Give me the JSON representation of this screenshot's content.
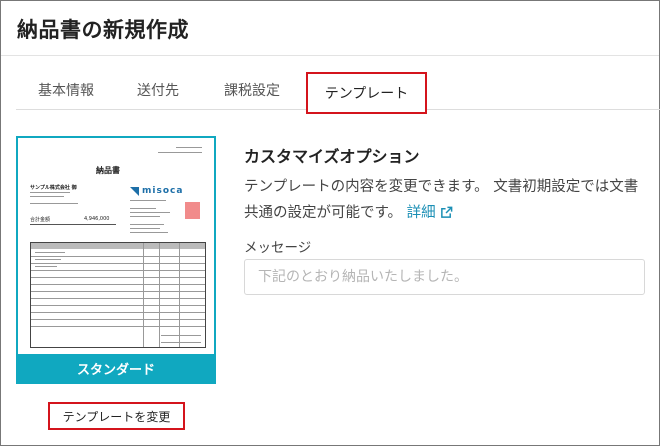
{
  "page": {
    "title": "納品書の新規作成"
  },
  "tabs": [
    {
      "label": "基本情報"
    },
    {
      "label": "送付先"
    },
    {
      "label": "課税設定"
    },
    {
      "label": "テンプレート"
    }
  ],
  "template": {
    "name": "スタンダード",
    "change_label": "テンプレートを変更",
    "preview": {
      "doc_title": "納品書",
      "customer": "サンプル株式会社 御",
      "brand": "misoca",
      "amount": "4,946,000"
    }
  },
  "options": {
    "title": "カスタマイズオプション",
    "description": "テンプレートの内容を変更できます。 文書初期設定では文書共通の設定が可能です。",
    "detail_link": "詳細",
    "message_label": "メッセージ",
    "message_placeholder": "下記のとおり納品いたしました。",
    "message_value": ""
  },
  "colors": {
    "accent": "#10a8c0",
    "highlight": "#d4141c",
    "link": "#1b8fb5"
  }
}
